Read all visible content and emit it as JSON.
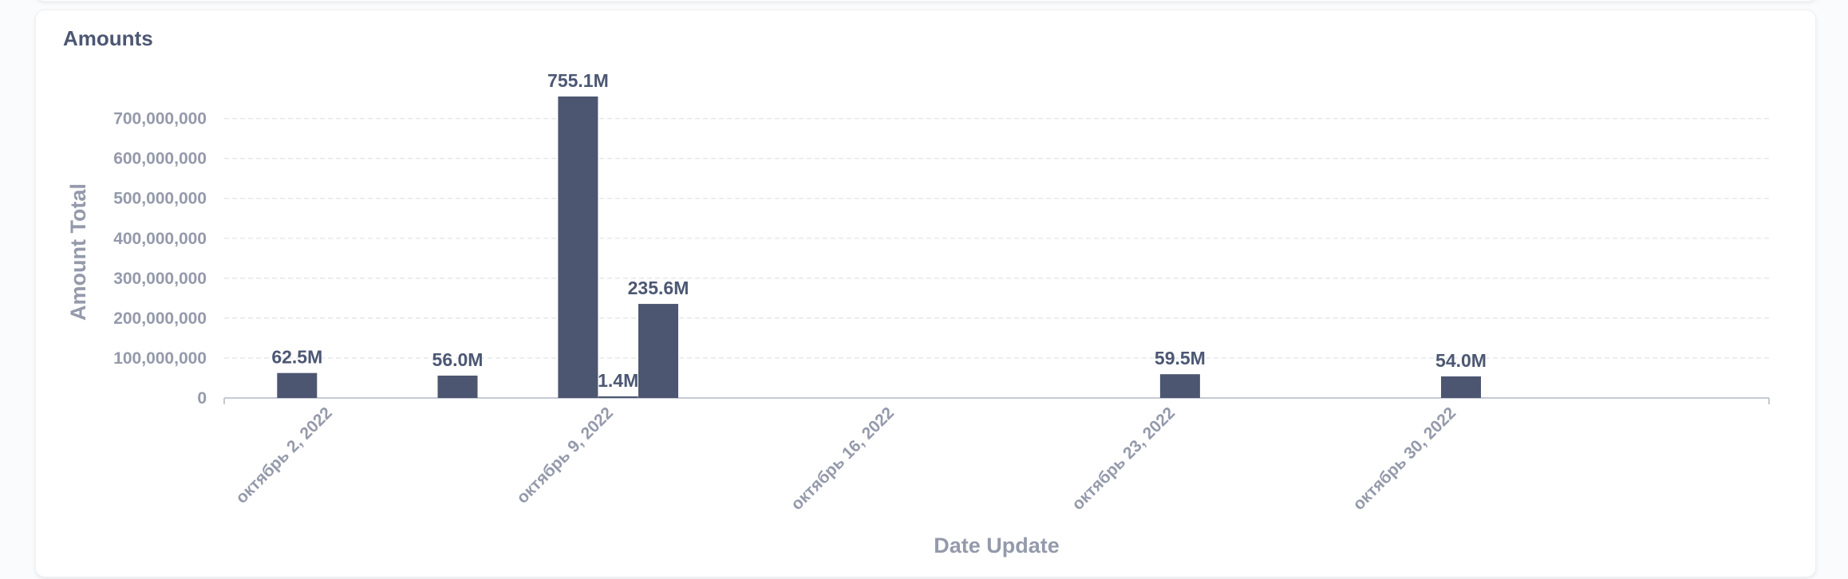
{
  "card": {
    "title": "Amounts"
  },
  "colors": {
    "bar": "#4c5670",
    "grid": "#e6e8ec",
    "axis": "#c6cad3",
    "tick_text": "#949aab",
    "label_text": "#4c5773"
  },
  "chart_data": {
    "type": "bar",
    "title": "Amounts",
    "xlabel": "Date Update",
    "ylabel": "Amount Total",
    "ylim": [
      0,
      755100000
    ],
    "y_ticks": [
      0,
      100000000,
      200000000,
      300000000,
      400000000,
      500000000,
      600000000,
      700000000
    ],
    "y_tick_labels": [
      "0",
      "100,000,000",
      "200,000,000",
      "300,000,000",
      "400,000,000",
      "500,000,000",
      "600,000,000",
      "700,000,000"
    ],
    "x_tick_labels": [
      "октябрь 2, 2022",
      "октябрь 9, 2022",
      "октябрь 16, 2022",
      "октябрь 23, 2022",
      "октябрь 30, 2022"
    ],
    "x_tick_dates": [
      "2022-10-02",
      "2022-10-09",
      "2022-10-16",
      "2022-10-23",
      "2022-10-30"
    ],
    "x_range": [
      "2022-10-01",
      "2022-11-01"
    ],
    "grid": true,
    "legend": "none",
    "bars": [
      {
        "date": "2022-10-02",
        "value": 62500000,
        "label": "62.5M"
      },
      {
        "date": "2022-10-06",
        "value": 56000000,
        "label": "56.0M"
      },
      {
        "date": "2022-10-09",
        "value": 755100000,
        "label": "755.1M"
      },
      {
        "date": "2022-10-10",
        "value": 1400000,
        "label": "1.4M"
      },
      {
        "date": "2022-10-11",
        "value": 235600000,
        "label": "235.6M"
      },
      {
        "date": "2022-10-24",
        "value": 59500000,
        "label": "59.5M"
      },
      {
        "date": "2022-10-31",
        "value": 54000000,
        "label": "54.0M"
      }
    ]
  }
}
